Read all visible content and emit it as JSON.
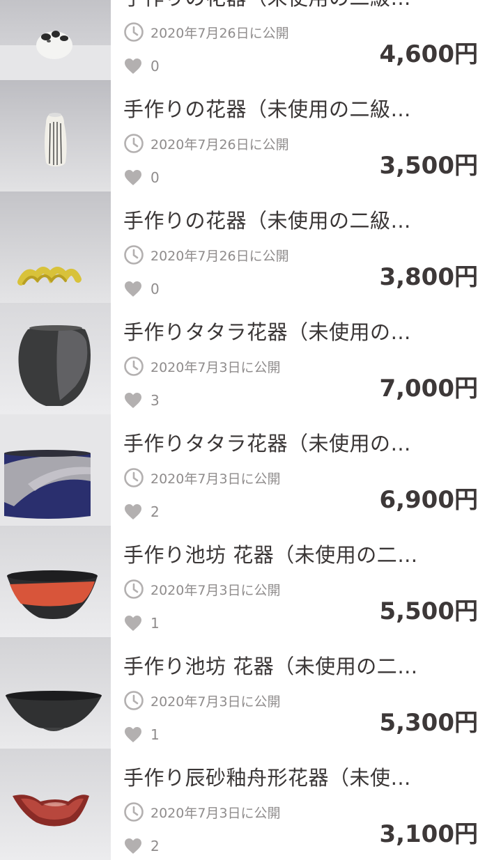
{
  "items": [
    {
      "title": "手作りの花器（未使用の二級…",
      "date": "2020年7月26日に公開",
      "likes": "0",
      "price": "4,600円",
      "image": "white-vase-with-dark-spots"
    },
    {
      "title": "手作りの花器（未使用の二級…",
      "date": "2020年7月26日に公開",
      "likes": "0",
      "price": "3,500円",
      "image": "striped-bud-vase"
    },
    {
      "title": "手作りの花器（未使用の二級…",
      "date": "2020年7月26日に公開",
      "likes": "0",
      "price": "3,800円",
      "image": "yellow-spiral-vase"
    },
    {
      "title": "手作りタタラ花器（未使用の…",
      "date": "2020年7月3日に公開",
      "likes": "3",
      "price": "7,000円",
      "image": "black-slab-vase"
    },
    {
      "title": "手作りタタラ花器（未使用の…",
      "date": "2020年7月3日に公開",
      "likes": "2",
      "price": "6,900円",
      "image": "navy-grey-cylinder-vase"
    },
    {
      "title": "手作り池坊 花器（未使用の二…",
      "date": "2020年7月3日に公開",
      "likes": "1",
      "price": "5,500円",
      "image": "red-black-conical-bowl"
    },
    {
      "title": "手作り池坊 花器（未使用の二…",
      "date": "2020年7月3日に公開",
      "likes": "1",
      "price": "5,300円",
      "image": "black-conical-bowl"
    },
    {
      "title": "手作り辰砂釉舟形花器（未使…",
      "date": "2020年7月3日に公開",
      "likes": "2",
      "price": "3,100円",
      "image": "red-boat-shaped-vase"
    }
  ],
  "icons": {
    "clock": "clock-icon",
    "heart": "heart-icon"
  },
  "colors": {
    "text": "#3a3636",
    "meta": "#8f8c8c",
    "icon": "#b3b0b0",
    "background": "#ffffff"
  }
}
